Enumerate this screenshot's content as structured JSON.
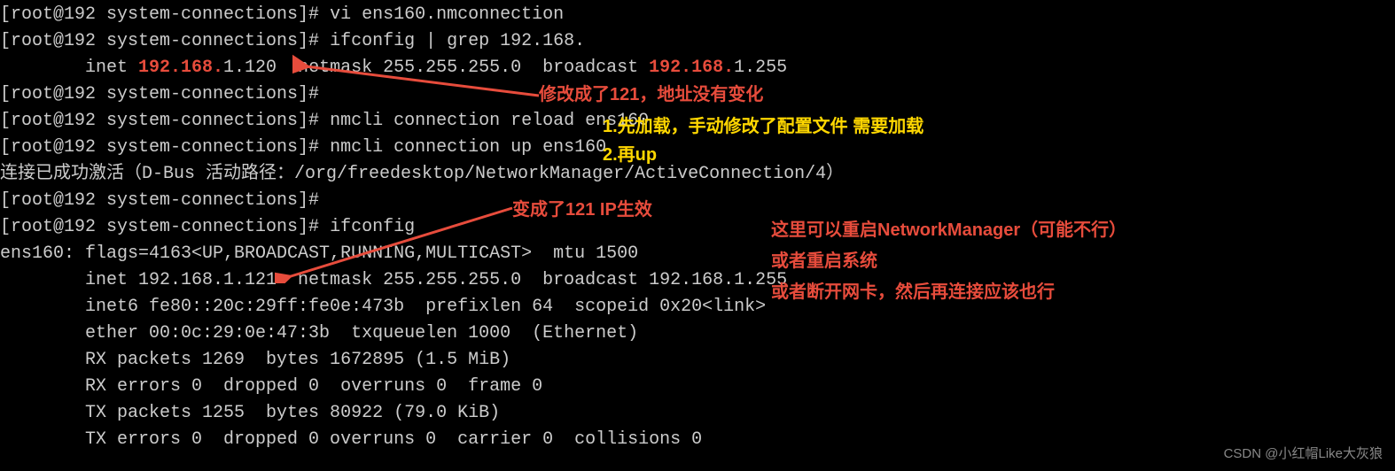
{
  "lines": {
    "l1_prompt": "[root@192 system-connections]# ",
    "l1_cmd": "vi ens160.nmconnection",
    "l2_prompt": "[root@192 system-connections]# ",
    "l2_cmd": "ifconfig | grep 192.168.",
    "l3_pre": "        inet ",
    "l3_red1": "192.168.",
    "l3_mid": "1.120  netmask 255.255.255.0  broadcast ",
    "l3_red2": "192.168.",
    "l3_end": "1.255",
    "l4": "[root@192 system-connections]#",
    "l5_prompt": "[root@192 system-connections]# ",
    "l5_cmd": "nmcli connection reload ens160",
    "l6_prompt": "[root@192 system-connections]# ",
    "l6_cmd": "nmcli connection up ens160",
    "l7": "连接已成功激活（D-Bus 活动路径：/org/freedesktop/NetworkManager/ActiveConnection/4）",
    "l8": "[root@192 system-connections]#",
    "l9_prompt": "[root@192 system-connections]# ",
    "l9_cmd": "ifconfig",
    "l10": "ens160: flags=4163<UP,BROADCAST,RUNNING,MULTICAST>  mtu 1500",
    "l11": "        inet 192.168.1.121  netmask 255.255.255.0  broadcast 192.168.1.255",
    "l12": "        inet6 fe80::20c:29ff:fe0e:473b  prefixlen 64  scopeid 0x20<link>",
    "l13": "        ether 00:0c:29:0e:47:3b  txqueuelen 1000  (Ethernet)",
    "l14": "        RX packets 1269  bytes 1672895 (1.5 MiB)",
    "l15": "        RX errors 0  dropped 0  overruns 0  frame 0",
    "l16": "        TX packets 1255  bytes 80922 (79.0 KiB)",
    "l17": "        TX errors 0  dropped 0 overruns 0  carrier 0  collisions 0"
  },
  "annotations": {
    "a1_pre": "修改成了",
    "a1_bold": "121",
    "a1_post": "，地址没有变化",
    "a2": "1.先加载，手动修改了配置文件 需要加载",
    "a3": "2.再up",
    "a4_pre": "变成了",
    "a4_bold": "121 IP",
    "a4_post": "生效",
    "a5": "这里可以重启NetworkManager（可能不行）",
    "a6": "或者重启系统",
    "a7": "或者断开网卡，然后再连接应该也行"
  },
  "watermark": "CSDN @小红帽Like大灰狼"
}
